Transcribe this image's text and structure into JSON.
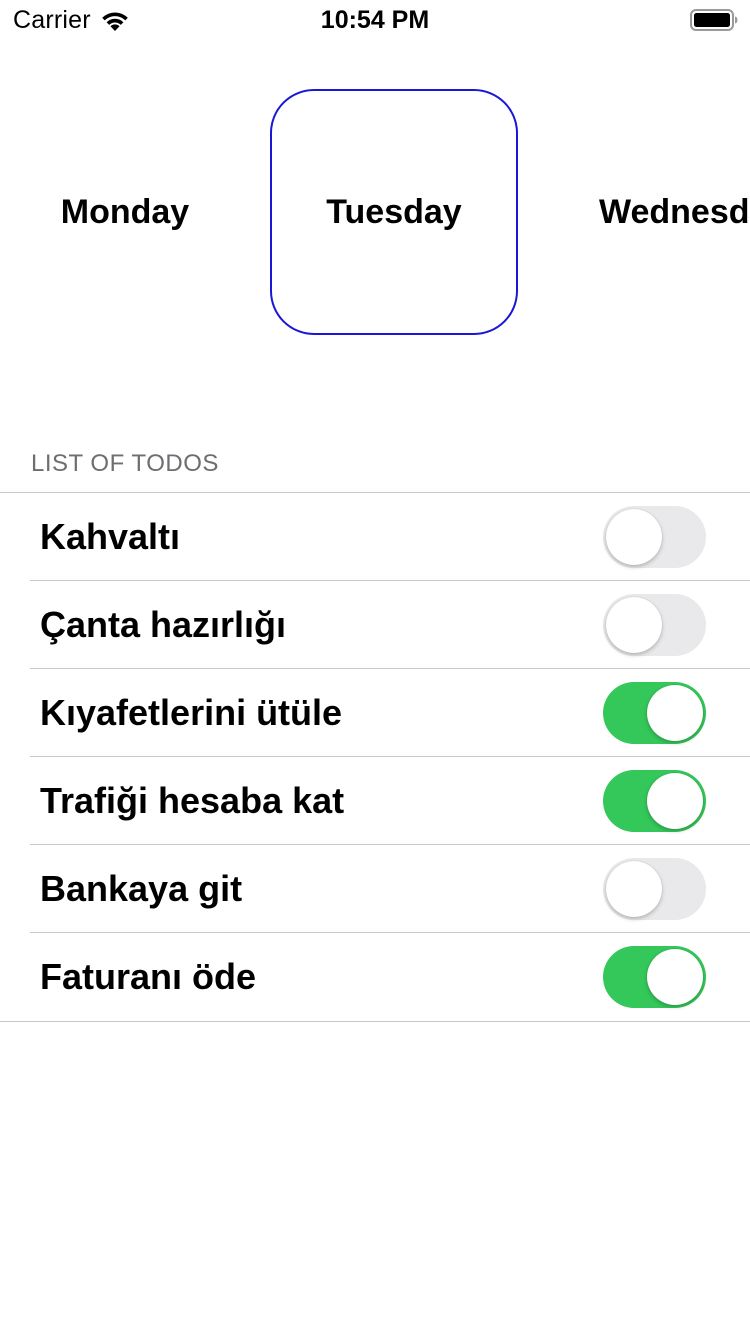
{
  "status_bar": {
    "carrier": "Carrier",
    "time": "10:54 PM",
    "wifi_icon": "wifi-icon",
    "battery_icon": "battery-icon"
  },
  "days": {
    "items": [
      {
        "label": "Monday",
        "selected": false
      },
      {
        "label": "Tuesday",
        "selected": true
      },
      {
        "label": "Wednesd",
        "selected": false
      }
    ],
    "selected_border_color": "#1a17d6"
  },
  "todos": {
    "header": "LIST OF TODOS",
    "items": [
      {
        "label": "Kahvaltı",
        "on": false
      },
      {
        "label": "Çanta hazırlığı",
        "on": false
      },
      {
        "label": "Kıyafetlerini ütüle",
        "on": true
      },
      {
        "label": "Trafiği hesaba kat",
        "on": true
      },
      {
        "label": "Bankaya git",
        "on": false
      },
      {
        "label": "Faturanı öde",
        "on": true
      }
    ],
    "toggle_on_color": "#34c759",
    "toggle_off_color": "#e9e9eb"
  }
}
